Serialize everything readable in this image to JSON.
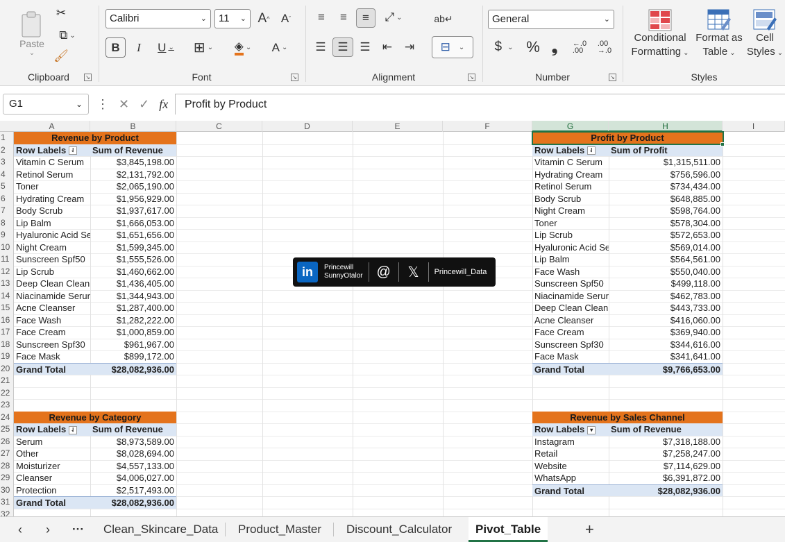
{
  "ribbon": {
    "clipboard": {
      "paste": "Paste",
      "label": "Clipboard"
    },
    "font": {
      "name": "Calibri",
      "size": "11",
      "label": "Font"
    },
    "alignment": {
      "label": "Alignment"
    },
    "number": {
      "format": "General",
      "label": "Number"
    },
    "styles": {
      "conditional": [
        "Conditional",
        "Formatting"
      ],
      "format_as": [
        "Format as",
        "Table"
      ],
      "cell": [
        "Cell",
        "Styles"
      ],
      "label": "Styles"
    }
  },
  "formula_bar": {
    "name_box": "G1",
    "formula": "Profit by Product"
  },
  "columns": [
    "A",
    "B",
    "C",
    "D",
    "E",
    "F",
    "G",
    "H",
    "I"
  ],
  "rows": [
    "1",
    "2",
    "3",
    "4",
    "5",
    "6",
    "7",
    "8",
    "9",
    "10",
    "11",
    "12",
    "13",
    "14",
    "15",
    "16",
    "17",
    "18",
    "19",
    "20",
    "21",
    "22",
    "23",
    "24",
    "25",
    "26",
    "27",
    "28",
    "29",
    "30",
    "31",
    "32"
  ],
  "pivot_revenue_product": {
    "title": "Revenue by Product",
    "col1": "Row Labels",
    "col2": "Sum of Revenue",
    "rows": [
      [
        "Vitamin C Serum",
        "$3,845,198.00"
      ],
      [
        "Retinol Serum",
        "$2,131,792.00"
      ],
      [
        "Toner",
        "$2,065,190.00"
      ],
      [
        "Hydrating Cream",
        "$1,956,929.00"
      ],
      [
        "Body Scrub",
        "$1,937,617.00"
      ],
      [
        "Lip Balm",
        "$1,666,053.00"
      ],
      [
        "Hyaluronic Acid Se",
        "$1,651,656.00"
      ],
      [
        "Night Cream",
        "$1,599,345.00"
      ],
      [
        "Sunscreen Spf50",
        "$1,555,526.00"
      ],
      [
        "Lip Scrub",
        "$1,460,662.00"
      ],
      [
        "Deep Clean Clean:",
        "$1,436,405.00"
      ],
      [
        "Niacinamide Serur",
        "$1,344,943.00"
      ],
      [
        "Acne Cleanser",
        "$1,287,400.00"
      ],
      [
        "Face Wash",
        "$1,282,222.00"
      ],
      [
        "Face Cream",
        "$1,000,859.00"
      ],
      [
        "Sunscreen Spf30",
        "$961,967.00"
      ],
      [
        "Face Mask",
        "$899,172.00"
      ]
    ],
    "total_label": "Grand Total",
    "total": "$28,082,936.00"
  },
  "pivot_profit_product": {
    "title": "Profit by Product",
    "col1": "Row Labels",
    "col2": "Sum of Profit",
    "rows": [
      [
        "Vitamin C Serum",
        "$1,315,511.00"
      ],
      [
        "Hydrating Cream",
        "$756,596.00"
      ],
      [
        "Retinol Serum",
        "$734,434.00"
      ],
      [
        "Body Scrub",
        "$648,885.00"
      ],
      [
        "Night Cream",
        "$598,764.00"
      ],
      [
        "Toner",
        "$578,304.00"
      ],
      [
        "Lip Scrub",
        "$572,653.00"
      ],
      [
        "Hyaluronic Acid Se",
        "$569,014.00"
      ],
      [
        "Lip Balm",
        "$564,561.00"
      ],
      [
        "Face Wash",
        "$550,040.00"
      ],
      [
        "Sunscreen Spf50",
        "$499,118.00"
      ],
      [
        "Niacinamide Serur",
        "$462,783.00"
      ],
      [
        "Deep Clean Clean:",
        "$443,733.00"
      ],
      [
        "Acne Cleanser",
        "$416,060.00"
      ],
      [
        "Face Cream",
        "$369,940.00"
      ],
      [
        "Sunscreen Spf30",
        "$344,616.00"
      ],
      [
        "Face Mask",
        "$341,641.00"
      ]
    ],
    "total_label": "Grand Total",
    "total": "$9,766,653.00"
  },
  "pivot_revenue_category": {
    "title": "Revenue by Category",
    "col1": "Row Labels",
    "col2": "Sum of Revenue",
    "rows": [
      [
        "Serum",
        "$8,973,589.00"
      ],
      [
        "Other",
        "$8,028,694.00"
      ],
      [
        "Moisturizer",
        "$4,557,133.00"
      ],
      [
        "Cleanser",
        "$4,006,027.00"
      ],
      [
        "Protection",
        "$2,517,493.00"
      ]
    ],
    "total_label": "Grand Total",
    "total": "$28,082,936.00"
  },
  "pivot_revenue_channel": {
    "title": "Revenue by Sales Channel",
    "col1": "Row Labels",
    "col2": "Sum of Revenue",
    "rows": [
      [
        "Instagram",
        "$7,318,188.00"
      ],
      [
        "Retail",
        "$7,258,247.00"
      ],
      [
        "Website",
        "$7,114,629.00"
      ],
      [
        "WhatsApp",
        "$6,391,872.00"
      ]
    ],
    "total_label": "Grand Total",
    "total": "$28,082,936.00"
  },
  "badge": {
    "linkedin_name": [
      "Princewill",
      "SunnyOtalor"
    ],
    "x_handle": "Princewill_Data"
  },
  "sheet_tabs": [
    "Clean_Skincare_Data",
    "Product_Master",
    "Discount_Calculator",
    "Pivot_Table"
  ],
  "active_tab": "Pivot_Table",
  "colors": {
    "pivot_title": "#e4731c",
    "pivot_header": "#dbe6f4",
    "excel_green": "#217346"
  }
}
